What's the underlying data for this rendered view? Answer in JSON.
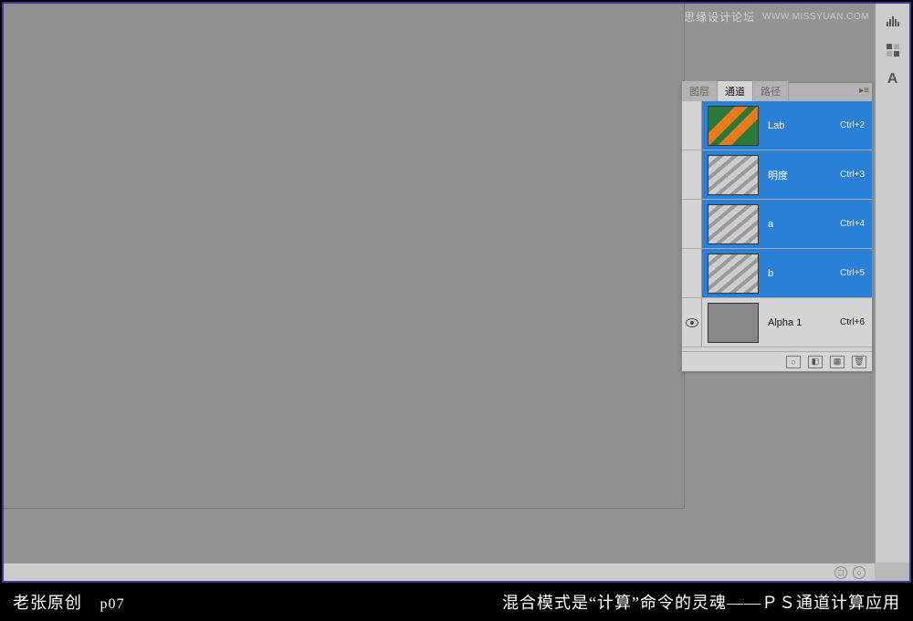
{
  "watermark": {
    "text": "思缘设计论坛",
    "url": "WWW.MISSYUAN.COM"
  },
  "panel": {
    "tabs": [
      "图层",
      "通道",
      "路径"
    ],
    "active_tab_index": 1,
    "channels": [
      {
        "name": "Lab",
        "shortcut": "Ctrl+2",
        "selected": true,
        "visible": false,
        "thumb": "color"
      },
      {
        "name": "明度",
        "shortcut": "Ctrl+3",
        "selected": true,
        "visible": false,
        "thumb": "gray"
      },
      {
        "name": "a",
        "shortcut": "Ctrl+4",
        "selected": true,
        "visible": false,
        "thumb": "gray"
      },
      {
        "name": "b",
        "shortcut": "Ctrl+5",
        "selected": true,
        "visible": false,
        "thumb": "gray"
      },
      {
        "name": "Alpha 1",
        "shortcut": "Ctrl+6",
        "selected": false,
        "visible": true,
        "thumb": "solid"
      }
    ],
    "footer_icons": [
      "load-selection-icon",
      "save-selection-icon",
      "new-channel-icon",
      "delete-channel-icon"
    ]
  },
  "toolbar_icons": [
    "levels-icon",
    "swatches-icon",
    "text-icon"
  ],
  "caption": {
    "author": "老张原创",
    "page": "p07",
    "title": "混合模式是“计算”命令的灵魂——ＰＳ通道计算应用"
  }
}
